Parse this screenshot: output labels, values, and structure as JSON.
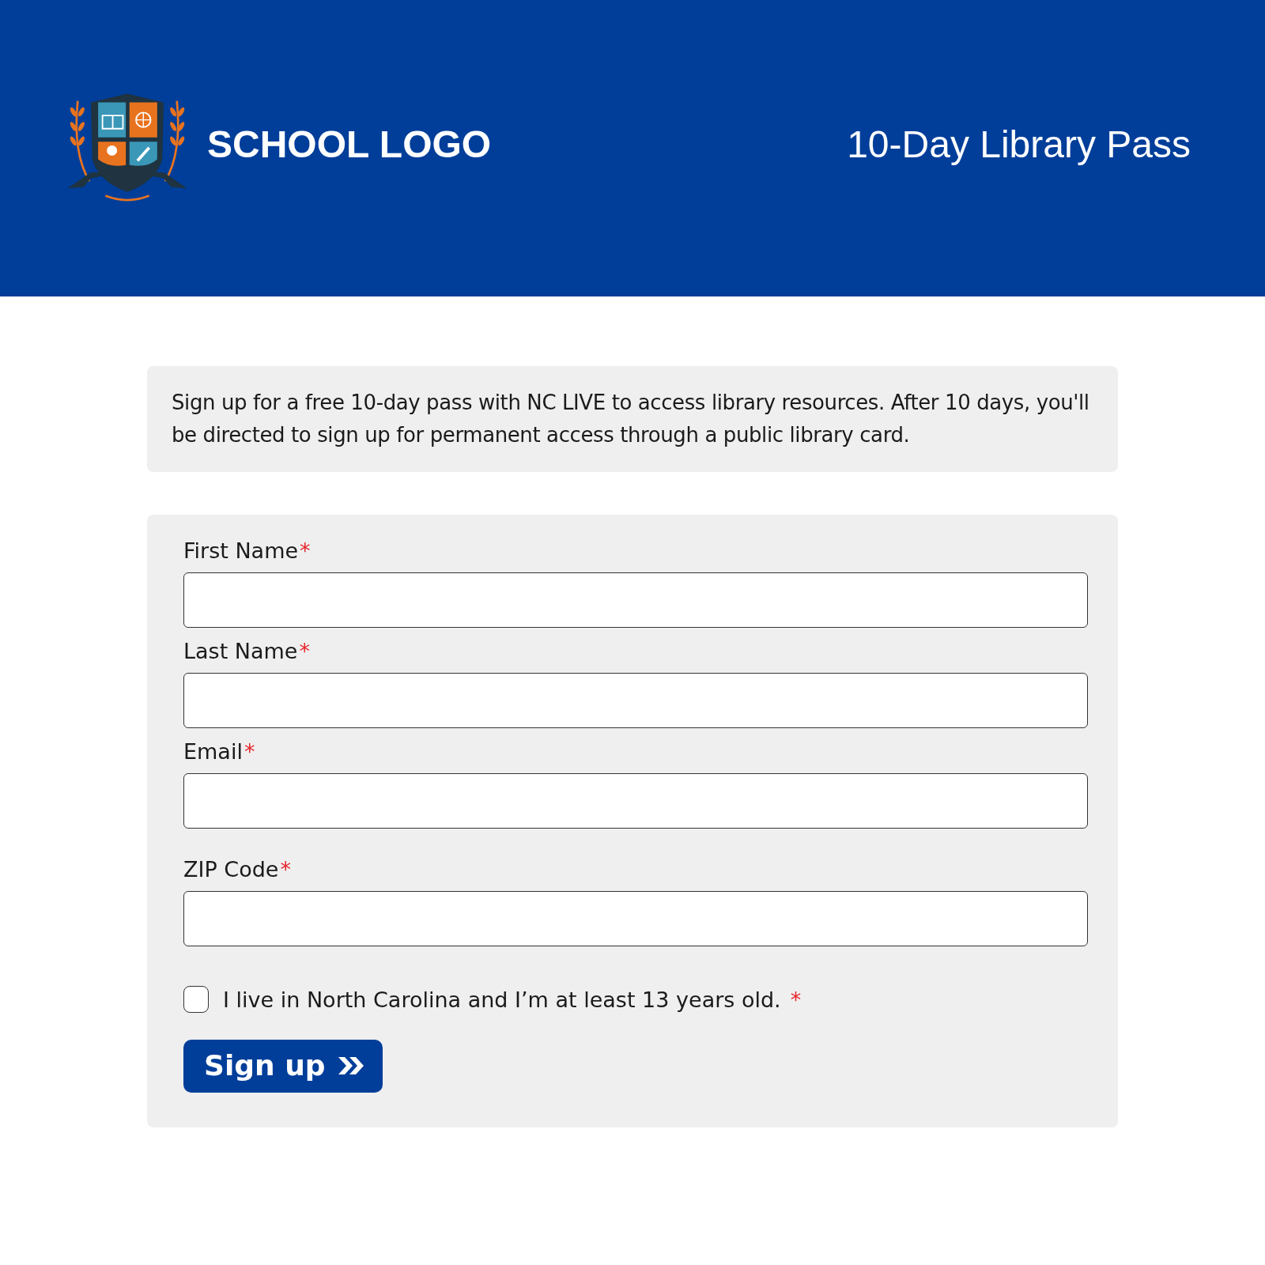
{
  "header": {
    "logo_text": "SCHOOL LOGO",
    "title": "10-Day Library Pass"
  },
  "intro": "Sign up for a free 10-day pass with NC LIVE to access library resources. After 10 days, you'll be directed to sign up for permanent access through a public library card.",
  "fields": [
    {
      "label": "First Name",
      "required_mark": "*"
    },
    {
      "label": "Last Name",
      "required_mark": "*"
    },
    {
      "label": "Email",
      "required_mark": "*"
    },
    {
      "label": "ZIP Code",
      "required_mark": "*"
    }
  ],
  "consent": {
    "label": "I live in North Carolina and I’m at least 13 years old.",
    "required_mark": "*",
    "checked": false
  },
  "submit": {
    "label": "Sign up"
  }
}
